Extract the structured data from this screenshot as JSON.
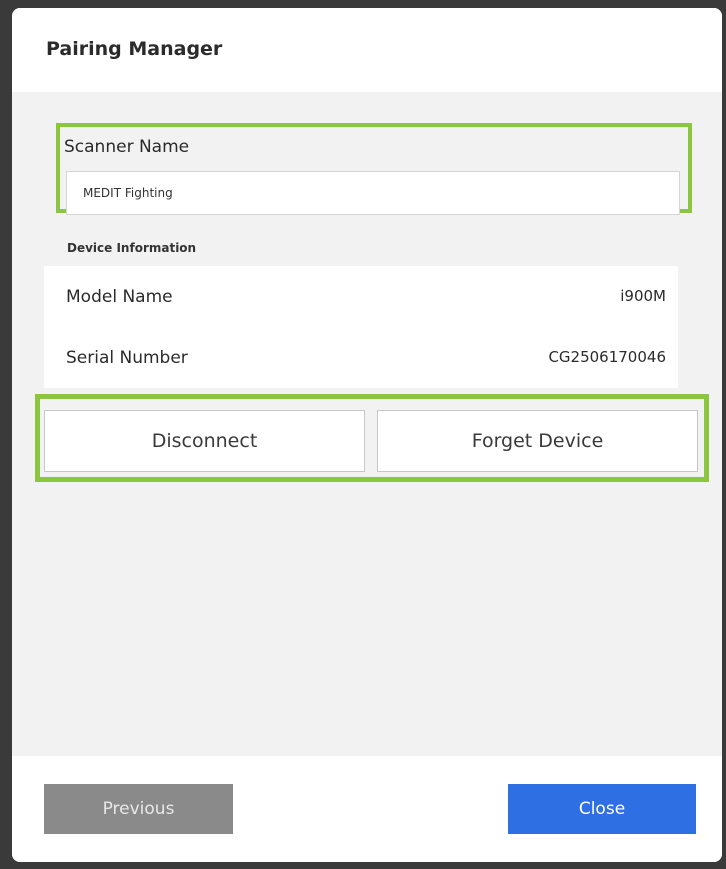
{
  "dialog": {
    "title": "Pairing Manager"
  },
  "scanner": {
    "label": "Scanner Name",
    "value": "MEDIT Fighting",
    "highlight_color": "#8cc63f"
  },
  "device_info": {
    "section_label": "Device Information",
    "rows": [
      {
        "key": "Model Name",
        "value": "i900M"
      },
      {
        "key": "Serial Number",
        "value": "CG2506170046"
      }
    ]
  },
  "actions": {
    "disconnect_label": "Disconnect",
    "forget_label": "Forget Device"
  },
  "footer": {
    "previous_label": "Previous",
    "close_label": "Close",
    "accent_color": "#2f6fe4"
  }
}
